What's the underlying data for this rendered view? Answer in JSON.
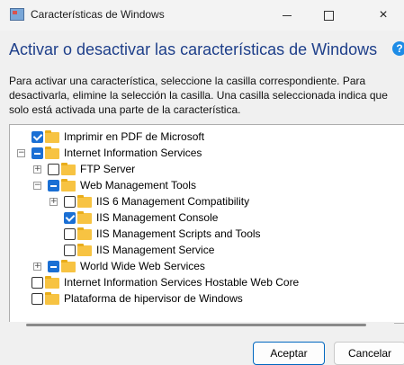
{
  "window": {
    "title": "Características de Windows",
    "minimize_icon": "minimize-icon",
    "maximize_icon": "maximize-icon",
    "close_glyph": "×"
  },
  "header": {
    "heading": "Activar o desactivar las características de Windows",
    "help_glyph": "?"
  },
  "description": {
    "line1": "Para activar una característica, seleccione la casilla correspondiente. Para",
    "line2": "desactivarla, elimine la selección la casilla. Una casilla seleccionada indica que",
    "line3": "solo está activada una parte de la característica."
  },
  "tree": {
    "items": [
      {
        "label": "Imprimir en PDF de Microsoft",
        "state": "checked",
        "expander": null
      },
      {
        "label": "Internet Information Services",
        "state": "partial",
        "expander": "−"
      },
      {
        "label": "FTP Server",
        "state": "unchecked",
        "expander": "+"
      },
      {
        "label": "Web Management Tools",
        "state": "partial",
        "expander": "−"
      },
      {
        "label": "IIS 6 Management Compatibility",
        "state": "unchecked",
        "expander": "+"
      },
      {
        "label": "IIS Management Console",
        "state": "checked",
        "expander": null
      },
      {
        "label": "IIS Management Scripts and Tools",
        "state": "unchecked",
        "expander": null
      },
      {
        "label": "IIS Management Service",
        "state": "unchecked",
        "expander": null
      },
      {
        "label": "World Wide Web Services",
        "state": "partial",
        "expander": "+"
      },
      {
        "label": "Internet Information Services Hostable Web Core",
        "state": "unchecked",
        "expander": null
      },
      {
        "label": "Plataforma de hipervisor de Windows",
        "state": "unchecked",
        "expander": null
      }
    ]
  },
  "buttons": {
    "ok": "Aceptar",
    "cancel": "Cancelar"
  },
  "colors": {
    "accent": "#1a6fd4",
    "heading": "#1e3f8a",
    "folder": "#f7c342"
  }
}
